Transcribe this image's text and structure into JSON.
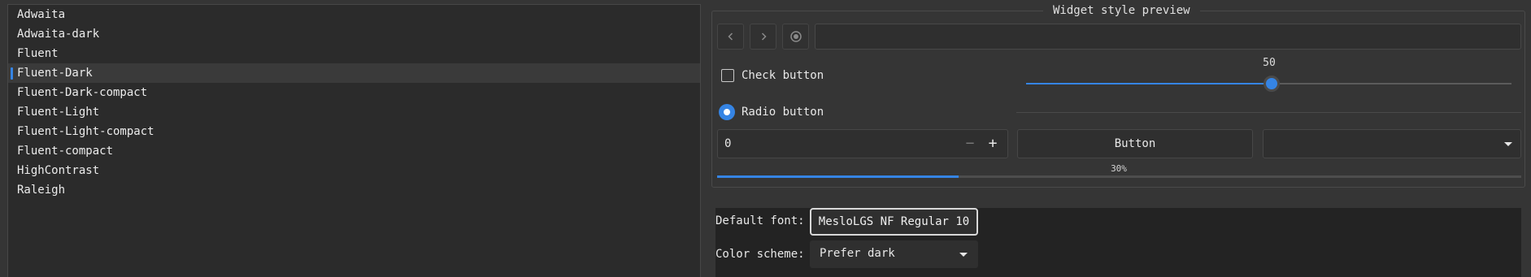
{
  "themes": {
    "items": [
      "Adwaita",
      "Adwaita-dark",
      "Fluent",
      "Fluent-Dark",
      "Fluent-Dark-compact",
      "Fluent-Light",
      "Fluent-Light-compact",
      "Fluent-compact",
      "HighContrast",
      "Raleigh"
    ],
    "selected": "Fluent-Dark"
  },
  "preview": {
    "title": "Widget style preview",
    "check_label": "Check button",
    "checked": false,
    "radio_label": "Radio button",
    "radio_selected": true,
    "slider_value": "50",
    "slider_fraction": 0.5,
    "spin_value": "0",
    "spin_minus": "−",
    "spin_plus": "+",
    "button_label": "Button",
    "progress_label": "30%",
    "progress_fraction": 0.3
  },
  "settings": {
    "font_label": "Default font:",
    "font_value": "MesloLGS NF Regular  10",
    "scheme_label": "Color scheme:",
    "scheme_value": "Prefer dark"
  },
  "colors": {
    "accent": "#3584e4",
    "window_bg": "#353535",
    "list_bg": "#2b2b2b"
  },
  "icons": [
    "go-back-icon",
    "go-forward-icon",
    "record-icon",
    "chevron-down-icon"
  ]
}
